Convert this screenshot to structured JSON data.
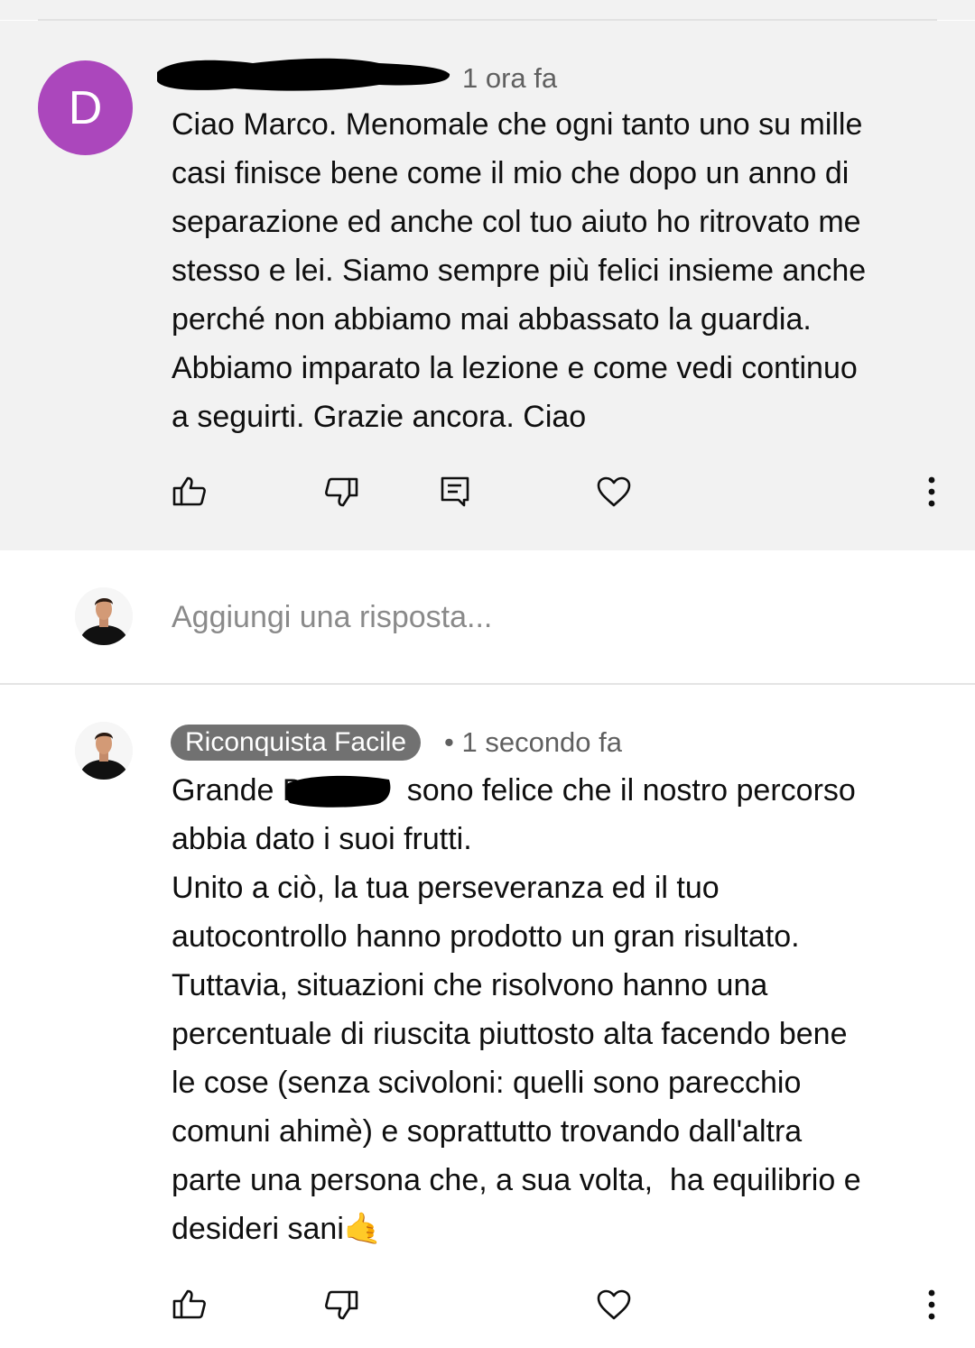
{
  "top_comment": {
    "avatar_letter": "D",
    "avatar_color": "#ab47bc",
    "time": "1 ora fa",
    "text": "Ciao Marco. Menomale che ogni tanto uno su mille\ncasi finisce bene come il mio che dopo un anno di\nseparazione ed anche col tuo aiuto ho ritrovato me\nstesso e lei. Siamo sempre più felici insieme anche\nperché non abbiamo mai abbassato la guardia.\nAbbiamo imparato la lezione e come vedi continuo\na seguirti. Grazie ancora. Ciao",
    "actions": [
      "like-icon",
      "dislike-icon",
      "reply-icon",
      "heart-icon",
      "more-icon"
    ]
  },
  "reply_box": {
    "placeholder": "Aggiungi una risposta..."
  },
  "reply_comment": {
    "author": "Riconquista Facile",
    "separator": "•",
    "time": "1 secondo fa",
    "text_start": "Grande D",
    "text": "Grande D            sono felice che il nostro percorso\nabbia dato i suoi frutti.\nUnito a ciò, la tua perseveranza ed il tuo\nautocontrollo hanno prodotto un gran risultato.\nTuttavia, situazioni che risolvono hanno una\npercentuale di riuscita piuttosto alta facendo bene\nle cose (senza scivoloni: quelli sono parecchio\ncomuni ahimè) e soprattutto trovando dall'altra\nparte una persona che, a sua volta,  ha equilibrio e\ndesideri sani🤙",
    "actions": [
      "like-icon",
      "dislike-icon",
      "heart-icon",
      "more-icon"
    ]
  },
  "colors": {
    "background_top": "#f2f2f2",
    "badge_bg": "#717171",
    "meta_text": "#606060"
  }
}
